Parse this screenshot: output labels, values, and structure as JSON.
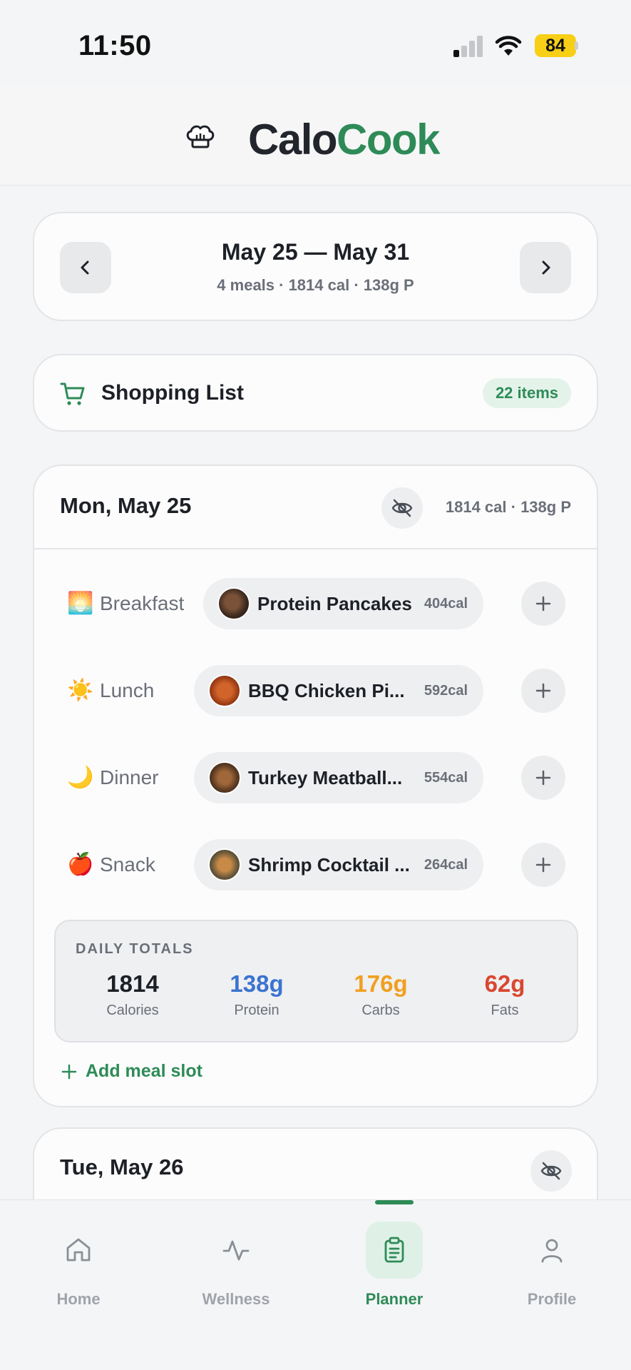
{
  "status_bar": {
    "time": "11:50",
    "battery": "84"
  },
  "header": {
    "brand_part1": "Calo",
    "brand_part2": "Cook"
  },
  "week": {
    "range": "May 25 — May 31",
    "summary": "4 meals · 1814 cal · 138g P"
  },
  "shopping": {
    "title": "Shopping List",
    "badge": "22 items"
  },
  "day": {
    "title": "Mon, May 25",
    "summary": "1814 cal · 138g P",
    "slots": [
      {
        "emoji": "🌅",
        "label": "Breakfast",
        "meal": "Protein Pancakes",
        "cal": "404cal"
      },
      {
        "emoji": "☀️",
        "label": "Lunch",
        "meal": "BBQ Chicken Pi...",
        "cal": "592cal"
      },
      {
        "emoji": "🌙",
        "label": "Dinner",
        "meal": "Turkey Meatball...",
        "cal": "554cal"
      },
      {
        "emoji": "🍎",
        "label": "Snack",
        "meal": "Shrimp Cocktail ...",
        "cal": "264cal"
      }
    ],
    "totals": {
      "heading": "DAILY TOTALS",
      "items": [
        {
          "value": "1814",
          "label": "Calories",
          "color": "#1d2026"
        },
        {
          "value": "138g",
          "label": "Protein",
          "color": "#3b74d0"
        },
        {
          "value": "176g",
          "label": "Carbs",
          "color": "#f0a020"
        },
        {
          "value": "62g",
          "label": "Fats",
          "color": "#d9472f"
        }
      ]
    },
    "add_slot": "Add meal slot"
  },
  "next_day": {
    "title": "Tue, May 26"
  },
  "tabs": [
    {
      "label": "Home",
      "icon": "home-icon"
    },
    {
      "label": "Wellness",
      "icon": "activity-icon"
    },
    {
      "label": "Planner",
      "icon": "clipboard-icon"
    },
    {
      "label": "Profile",
      "icon": "user-icon"
    }
  ],
  "colors": {
    "accent": "#2e8b57",
    "protein": "#3b74d0",
    "carbs": "#f0a020",
    "fats": "#d9472f"
  }
}
